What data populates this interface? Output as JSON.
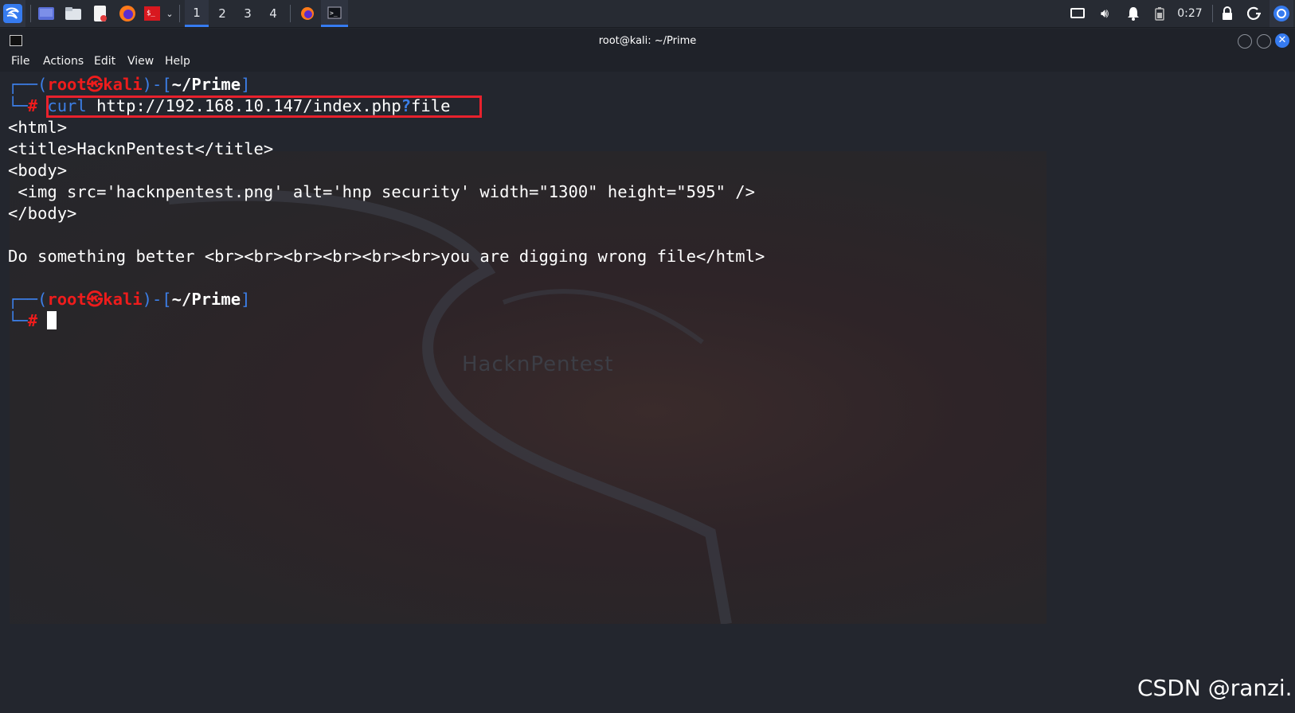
{
  "taskbar": {
    "workspaces": [
      "1",
      "2",
      "3",
      "4"
    ],
    "active_workspace": "1",
    "clock": "0:27",
    "icons": [
      "kali-menu-icon",
      "desktop-icon",
      "files-icon",
      "text-editor-icon",
      "firefox-icon",
      "terminal-launcher-icon",
      "chevron-down-icon",
      "firefox-task-icon",
      "terminal-task-icon",
      "screen-icon",
      "volume-icon",
      "notification-bell-icon",
      "battery-icon",
      "lock-icon",
      "power-icon",
      "browser-icon"
    ],
    "accent": "#367bf0"
  },
  "window": {
    "title": "root@kali: ~/Prime"
  },
  "menu": {
    "file": "File",
    "actions": "Actions",
    "edit": "Edit",
    "view": "View",
    "help": "Help"
  },
  "terminal": {
    "prompt1": {
      "open": "┌──(",
      "user": "root",
      "skull": "㉿",
      "host": "kali",
      "mid": ")-[",
      "path": "~/Prime",
      "close": "]",
      "corner": "└─",
      "hash": "#"
    },
    "command": {
      "pre": "curl ",
      "url": "http://192.168.10.147/index.php",
      "q": "?",
      "post": "file"
    },
    "output": [
      "<html>",
      "<title>HacknPentest</title>",
      "<body>",
      " <img src='hacknpentest.png' alt='hnp security' width=\"1300\" height=\"595\" />",
      "</body>",
      "",
      "Do something better <br><br><br><br><br><br>you are digging wrong file</html>"
    ],
    "prompt2": {
      "open": "┌──(",
      "user": "root",
      "skull": "㉿",
      "host": "kali",
      "mid": ")-[",
      "path": "~/Prime",
      "close": "]",
      "corner": "└─",
      "hash": "#"
    },
    "highlight_color": "#e8212d"
  },
  "background_logo_text": "HacknPentest",
  "watermark": "CSDN @ranzi."
}
